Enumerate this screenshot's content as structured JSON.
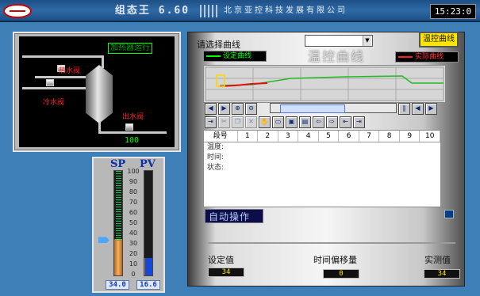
{
  "header": {
    "title": "组态王 6.60",
    "company": "北京亚控科技发展有限公司",
    "time": "15:23:0"
  },
  "process": {
    "status_label": "加热器运行",
    "hot_water_valve": "热水阀",
    "cold_water_valve": "冷水阀",
    "outlet_valve": "出水阀",
    "outlet_value": "100"
  },
  "gauges": {
    "sp_label": "SP",
    "pv_label": "PV",
    "scale": [
      "100",
      "90",
      "80",
      "70",
      "60",
      "50",
      "40",
      "30",
      "20",
      "10",
      "0"
    ],
    "sp_value": "34.0",
    "pv_value": "16.6",
    "sp_fraction": 0.34,
    "pv_fraction": 0.166,
    "fill_color": "#f7b060"
  },
  "right_panel": {
    "select_curve_label": "请选择曲线",
    "select_value": "",
    "temp_control_button": "温控曲线",
    "legend_set": "设定曲线",
    "legend_actual": "实际曲线",
    "curve_title": "温控曲线",
    "set_color": "#00ff00",
    "actual_color": "#ff2020",
    "table": {
      "columns": [
        "段号",
        "1",
        "2",
        "3",
        "4",
        "5",
        "6",
        "7",
        "8",
        "9",
        "10"
      ],
      "rows": [
        "温度:",
        "时间:",
        "状态:"
      ]
    },
    "auto_label": "自动操作",
    "setpoint_label": "设定值",
    "setpoint_value": "34",
    "time_offset_label": "时间偏移量",
    "time_offset_value": "0",
    "actual_label": "实测值",
    "actual_value": "34"
  }
}
